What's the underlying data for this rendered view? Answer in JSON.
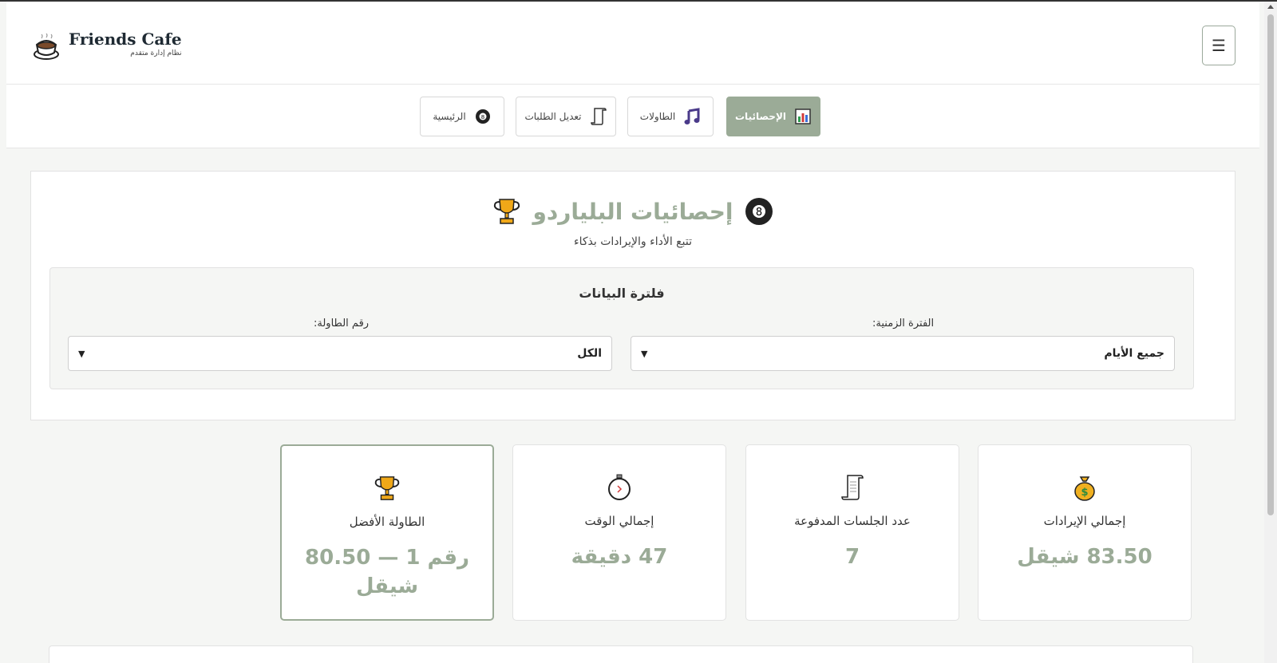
{
  "brand": {
    "name": "Friends Cafe",
    "subtitle": "نظام إدارة متقدم"
  },
  "header": {
    "menu_icon": "☰"
  },
  "nav": {
    "items": [
      {
        "label": "الإحصائيات",
        "icon": "chart-icon",
        "active": true
      },
      {
        "label": "الطاولات",
        "icon": "music-notes-icon",
        "active": false
      },
      {
        "label": "تعديل الطلبات",
        "icon": "scroll-icon",
        "active": false
      },
      {
        "label": "الرئيسية",
        "icon": "billiard-ball-icon",
        "active": false
      }
    ]
  },
  "page": {
    "title": "إحصائيات البلياردو",
    "subtitle": "تتبع الأداء والإيرادات بذكاء"
  },
  "filter": {
    "title": "فلترة البيانات",
    "period_label": "الفترة الزمنية:",
    "period_value": "جميع الأيام",
    "table_label": "رقم الطاولة:",
    "table_value": "الكل"
  },
  "cards": [
    {
      "label": "إجمالي الإيرادات",
      "value": "83.50 شيقل",
      "icon": "money-bag-icon"
    },
    {
      "label": "عدد الجلسات المدفوعة",
      "value": "7",
      "icon": "scroll-icon"
    },
    {
      "label": "إجمالي الوقت",
      "value": "47 دقيقة",
      "icon": "stopwatch-icon"
    },
    {
      "label": "الطاولة الأفضل",
      "value": "رقم 1 — 80.50 شيقل",
      "icon": "trophy-icon"
    }
  ],
  "colors": {
    "accent": "#9bab97",
    "text": "#333333",
    "background": "#f5f6f4"
  }
}
